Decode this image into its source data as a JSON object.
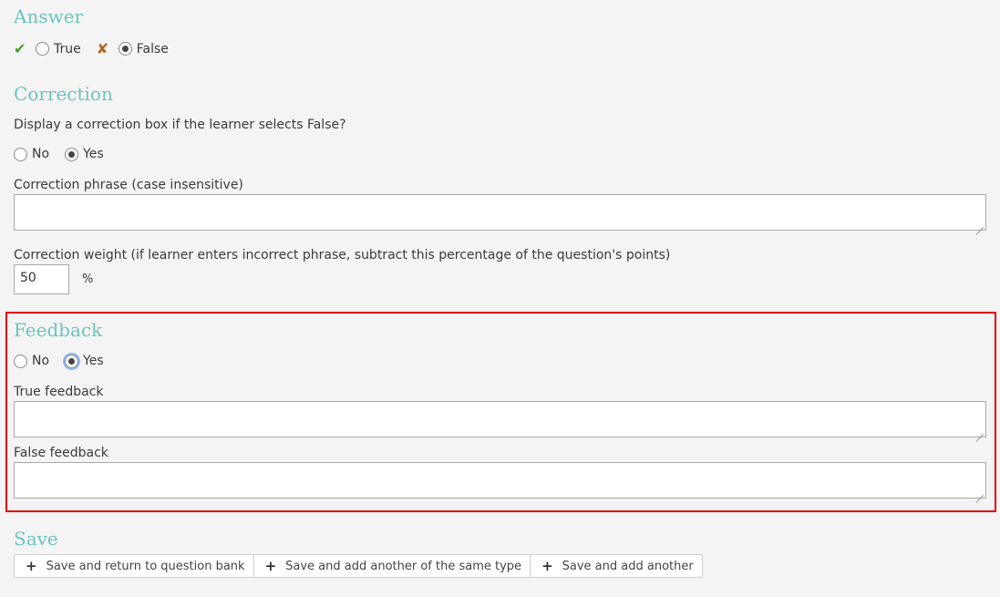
{
  "answer": {
    "heading": "Answer",
    "true_label": "True",
    "false_label": "False",
    "selected": "False"
  },
  "correction": {
    "heading": "Correction",
    "question": "Display a correction box if the learner selects False?",
    "no_label": "No",
    "yes_label": "Yes",
    "selected": "Yes",
    "phrase_label": "Correction phrase (case insensitive)",
    "phrase_value": "",
    "weight_label": "Correction weight (if learner enters incorrect phrase, subtract this percentage of the question's points)",
    "weight_value": "50",
    "weight_unit": "%"
  },
  "feedback": {
    "heading": "Feedback",
    "no_label": "No",
    "yes_label": "Yes",
    "selected": "Yes",
    "true_label": "True feedback",
    "true_value": "",
    "false_label": "False feedback",
    "false_value": ""
  },
  "save": {
    "heading": "Save",
    "buttons": [
      {
        "label": "Save and return to question bank",
        "icon": "plus-icon"
      },
      {
        "label": "Save and add another of the same type",
        "icon": "plus-icon"
      },
      {
        "label": "Save and add another",
        "icon": "plus-icon"
      }
    ]
  },
  "colors": {
    "heading": "#6cc3bf",
    "highlight_border": "#e00000",
    "check": "#4a9a2a",
    "cross": "#b5651d"
  }
}
